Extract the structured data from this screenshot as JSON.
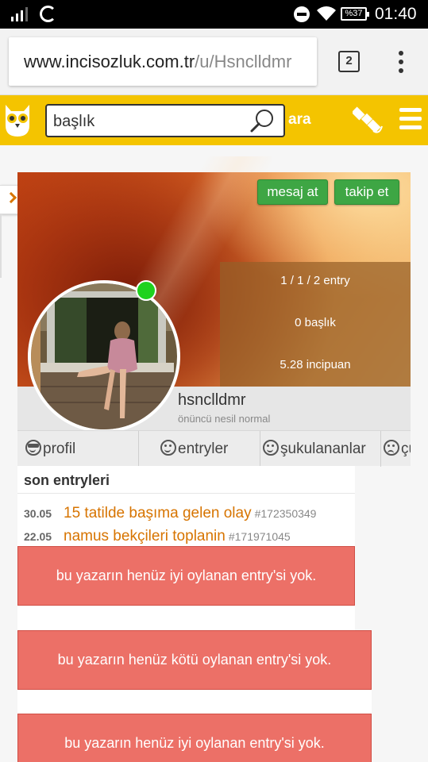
{
  "status_bar": {
    "battery": "%37",
    "time": "01:40"
  },
  "browser": {
    "url_domain": "www.incisozluk.com.tr",
    "url_path": "/u/Hsnclldmr",
    "tab_count": "2"
  },
  "header": {
    "search_value": "başlık",
    "search_button": "ara"
  },
  "profile": {
    "message_button": "mesaj at",
    "follow_button": "takip et",
    "stats": {
      "entries": "1 / 1 / 2 entry",
      "titles": "0 başlık",
      "points": "5.28 incipuan"
    },
    "username": "hsnclldmr",
    "rank": "önüncü nesil normal",
    "online": true
  },
  "tabs": [
    {
      "label": "profil",
      "icon": "cool-face-icon"
    },
    {
      "label": "entryler",
      "icon": "smile-icon"
    },
    {
      "label": "şukulananlar",
      "icon": "smile-icon"
    },
    {
      "label": "çük",
      "icon": "sad-face-icon"
    }
  ],
  "entries": {
    "heading": "son entryleri",
    "items": [
      {
        "date": "30.05",
        "title": "15 tatilde başıma gelen olay",
        "id": "#172350349"
      },
      {
        "date": "22.05",
        "title": "namus bekçileri toplanin",
        "id": "#171971045"
      }
    ]
  },
  "notices": [
    "bu yazarın henüz iyi oylanan entry'si yok.",
    "bu yazarın henüz kötü oylanan entry'si yok.",
    "bu yazarın henüz iyi oylanan entry'si yok."
  ],
  "colors": {
    "brand_yellow": "#f4c400",
    "link_orange": "#d77400",
    "notice_red": "#ec7067",
    "button_green": "#3ea644",
    "online_green": "#1ed21e"
  }
}
